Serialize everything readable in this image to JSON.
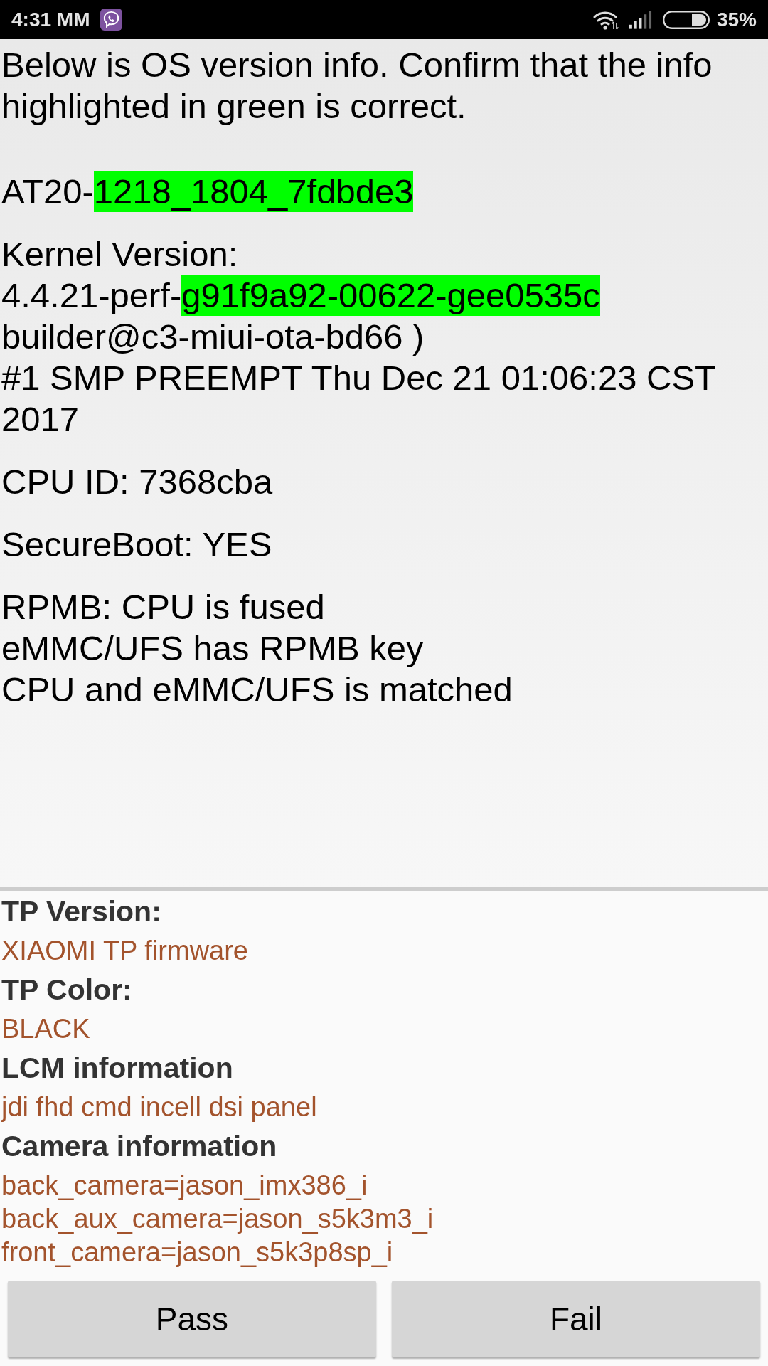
{
  "status_bar": {
    "time": "4:31 MM",
    "battery": "35%"
  },
  "os_info": {
    "intro": "Below is OS version info. Confirm that the info highlighted in green is correct.",
    "blocks": [
      {
        "lines": [
          {
            "parts": [
              {
                "text": "AT20-",
                "highlighted": false
              },
              {
                "text": "1218_1804_7fdbde3",
                "highlighted": true
              }
            ]
          }
        ]
      },
      {
        "lines": [
          {
            "parts": [
              {
                "text": "Kernel Version:",
                "highlighted": false
              }
            ]
          },
          {
            "parts": [
              {
                "text": "4.4.21-perf-",
                "highlighted": false
              },
              {
                "text": "g91f9a92-00622-gee0535c",
                "highlighted": true
              }
            ]
          },
          {
            "parts": [
              {
                "text": "builder@c3-miui-ota-bd66 )",
                "highlighted": false
              }
            ]
          },
          {
            "parts": [
              {
                "text": "#1 SMP PREEMPT Thu Dec 21 01:06:23 CST 2017",
                "highlighted": false
              }
            ]
          }
        ]
      },
      {
        "lines": [
          {
            "parts": [
              {
                "text": "CPU ID: 7368cba",
                "highlighted": false
              }
            ]
          }
        ]
      },
      {
        "lines": [
          {
            "parts": [
              {
                "text": "SecureBoot: YES",
                "highlighted": false
              }
            ]
          }
        ]
      },
      {
        "lines": [
          {
            "parts": [
              {
                "text": "RPMB: CPU is fused",
                "highlighted": false
              }
            ]
          },
          {
            "parts": [
              {
                "text": "eMMC/UFS has RPMB key",
                "highlighted": false
              }
            ]
          },
          {
            "parts": [
              {
                "text": "CPU and eMMC/UFS is matched",
                "highlighted": false
              }
            ]
          }
        ]
      }
    ]
  },
  "device_info": [
    {
      "heading": "TP Version:",
      "values": [
        "XIAOMI TP firmware"
      ]
    },
    {
      "heading": "TP Color:",
      "values": [
        "BLACK"
      ]
    },
    {
      "heading": "LCM information",
      "values": [
        "jdi fhd cmd incell dsi panel"
      ]
    },
    {
      "heading": "Camera information",
      "values": [
        "back_camera=jason_imx386_i",
        "back_aux_camera=jason_s5k3m3_i",
        "front_camera=jason_s5k3p8sp_i"
      ]
    }
  ],
  "buttons": [
    "Pass",
    "Fail"
  ]
}
